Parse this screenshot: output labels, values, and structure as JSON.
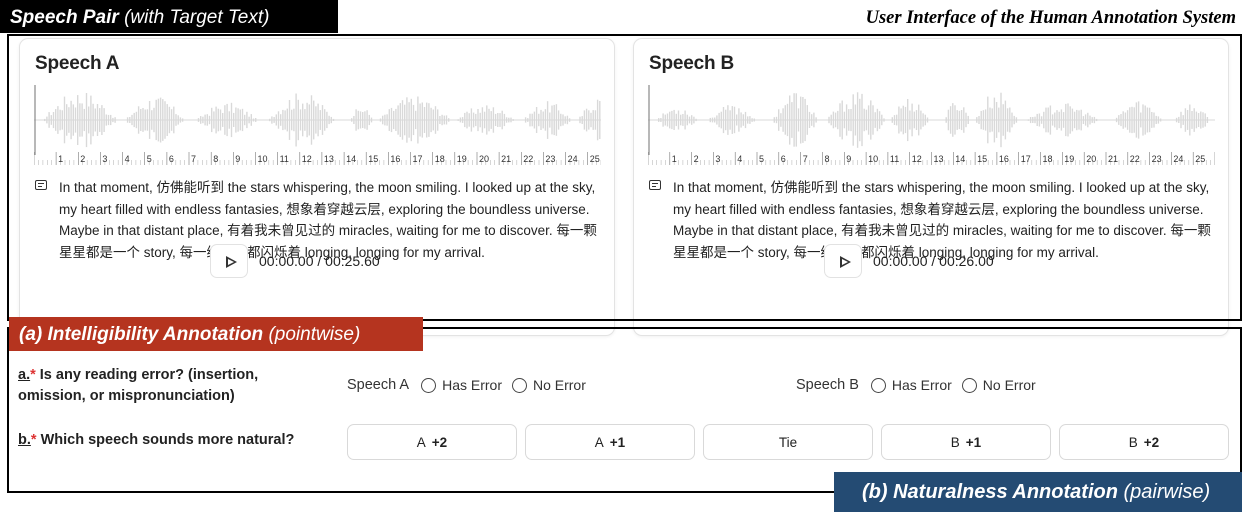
{
  "labels": {
    "top_tag_main": "Speech Pair",
    "top_tag_sub": "(with Target Text)",
    "system_title": "User Interface of the Human Annotation System",
    "intel_tag_main": "(a) Intelligibility Annotation",
    "intel_tag_sub": "(pointwise)",
    "nat_tag_main": "(b) Naturalness Annotation",
    "nat_tag_sub": "(pairwise)"
  },
  "speech_a": {
    "title": "Speech A",
    "transcript": "In that moment, 仿佛能听到 the stars whispering, the moon smiling. I looked up at the sky, my heart filled with endless fantasies, 想象着穿越云层, exploring the boundless universe. Maybe in that distant place, 有着我未曾见过的 miracles, waiting for me to discover. 每一颗星星都是一个 story, 每一缕星光都闪烁着 longing, longing for my arrival.",
    "time": "00:00.00 / 00:25.60",
    "duration_seconds": 25.6
  },
  "speech_b": {
    "title": "Speech B",
    "transcript": "In that moment, 仿佛能听到 the stars whispering, the moon smiling. I looked up at the sky, my heart filled with endless fantasies, 想象着穿越云层, exploring the boundless universe. Maybe in that distant place, 有着我未曾见过的 miracles, waiting for me to discover. 每一颗星星都是一个 story, 每一缕星光都闪烁着 longing, longing for my arrival.",
    "time": "00:00.00 / 00:26.00",
    "duration_seconds": 26.0
  },
  "ruler_labels": [
    "1",
    "2",
    "3",
    "4",
    "5",
    "6",
    "7",
    "8",
    "9",
    "10",
    "11",
    "12",
    "13",
    "14",
    "15",
    "16",
    "17",
    "18",
    "19",
    "20",
    "21",
    "22",
    "23",
    "24",
    "25"
  ],
  "question_a": {
    "number": "a.",
    "required_mark": "*",
    "text": " Is any reading error? (insertion, omission, or mispronunciation)",
    "group_a_label": "Speech A",
    "group_b_label": "Speech B",
    "option_1": "Has Error",
    "option_2": "No Error"
  },
  "question_b": {
    "number": "b.",
    "required_mark": "*",
    "text": " Which speech sounds more natural?",
    "choices": [
      {
        "prefix": "A",
        "strength": "+2"
      },
      {
        "prefix": "A",
        "strength": "+1"
      },
      {
        "prefix": "Tie",
        "strength": ""
      },
      {
        "prefix": "B",
        "strength": "+1"
      },
      {
        "prefix": "B",
        "strength": "+2"
      }
    ]
  },
  "colors": {
    "intel_tag": "#b5341f",
    "nat_tag": "#244b73",
    "waveform": "#d9d9d9"
  }
}
